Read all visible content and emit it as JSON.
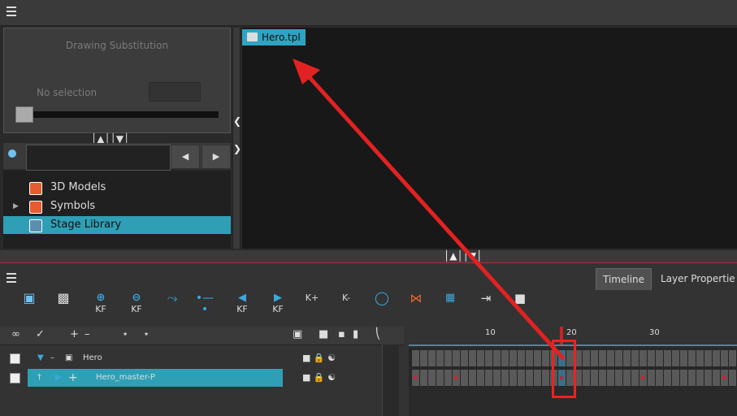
{
  "top": {
    "menu_icon": "hamburger-menu-icon"
  },
  "drawing_substitution": {
    "title": "Drawing Substitution",
    "no_selection": "No selection"
  },
  "library": {
    "search_placeholder": "",
    "tree": [
      {
        "label": "3D Models",
        "icon": "folder-icon",
        "expandable": false,
        "selected": false
      },
      {
        "label": "Symbols",
        "icon": "folder-icon",
        "expandable": true,
        "selected": false
      },
      {
        "label": "Stage Library",
        "icon": "folder-icon",
        "expandable": false,
        "selected": true
      }
    ]
  },
  "file_view": {
    "template_name": "Hero.tpl"
  },
  "bottom": {
    "tabs": [
      {
        "label": "Timeline",
        "active": true
      },
      {
        "label": "Layer Propertie",
        "active": false
      }
    ],
    "toolbar_labels": [
      "KF",
      "KF",
      "KF",
      "KF",
      "K+",
      "K-"
    ],
    "ruler_ticks": [
      "10",
      "20",
      "30"
    ],
    "layers": [
      {
        "name": "Hero",
        "checked": true,
        "selected": false
      },
      {
        "name": "Hero_master-P",
        "checked": true,
        "selected": true
      }
    ]
  },
  "colors": {
    "selection": "#2f9fb5",
    "annotation_red": "#e22222",
    "panel_bg": "#2a2a2a"
  }
}
